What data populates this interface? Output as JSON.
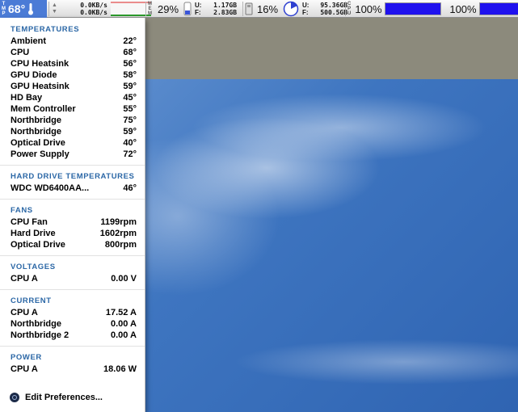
{
  "menubar": {
    "temp": {
      "label_letters": [
        "T",
        "M",
        "P"
      ],
      "value": "68°"
    },
    "network": {
      "up": "0.0KB/s",
      "down": "0.0KB/s"
    },
    "memory": {
      "label_letters": [
        "M",
        "E",
        "M"
      ],
      "percent": "29%",
      "used_label": "U:",
      "used": "1.17GB",
      "free_label": "F:",
      "free": "2.83GB"
    },
    "disk": {
      "percent": "16%",
      "used_label": "U:",
      "used": "95.36GB",
      "free_label": "F:",
      "free": "500.5GB"
    },
    "cpu": [
      {
        "percent": "100%",
        "level": 1.0
      },
      {
        "percent": "100%",
        "level": 1.0
      }
    ],
    "cpu_label_letters": [
      "C",
      "P",
      "U"
    ],
    "colors": {
      "temp_bg": "#4b7bd6",
      "cpu_bar": "#1f11ee",
      "section_heading": "#2b67a6"
    }
  },
  "menu": {
    "temperatures": {
      "heading": "TEMPERATURES",
      "rows": [
        {
          "name": "Ambient",
          "value": "22°"
        },
        {
          "name": "CPU",
          "value": "68°"
        },
        {
          "name": "CPU Heatsink",
          "value": "56°"
        },
        {
          "name": "GPU Diode",
          "value": "58°"
        },
        {
          "name": "GPU Heatsink",
          "value": "59°"
        },
        {
          "name": "HD Bay",
          "value": "45°"
        },
        {
          "name": "Mem Controller",
          "value": "55°"
        },
        {
          "name": "Northbridge",
          "value": "75°"
        },
        {
          "name": "Northbridge",
          "value": "59°"
        },
        {
          "name": "Optical Drive",
          "value": "40°"
        },
        {
          "name": "Power Supply",
          "value": "72°"
        }
      ]
    },
    "hd_temperatures": {
      "heading": "HARD DRIVE TEMPERATURES",
      "rows": [
        {
          "name": "WDC WD6400AA...",
          "value": "46°"
        }
      ]
    },
    "fans": {
      "heading": "FANS",
      "rows": [
        {
          "name": "CPU Fan",
          "value": "1199rpm"
        },
        {
          "name": "Hard Drive",
          "value": "1602rpm"
        },
        {
          "name": "Optical Drive",
          "value": "800rpm"
        }
      ]
    },
    "voltages": {
      "heading": "VOLTAGES",
      "rows": [
        {
          "name": "CPU A",
          "value": "0.00 V"
        }
      ]
    },
    "current": {
      "heading": "CURRENT",
      "rows": [
        {
          "name": "CPU A",
          "value": "17.52 A"
        },
        {
          "name": "Northbridge",
          "value": "0.00 A"
        },
        {
          "name": "Northbridge 2",
          "value": "0.00 A"
        }
      ]
    },
    "power": {
      "heading": "POWER",
      "rows": [
        {
          "name": "CPU A",
          "value": "18.06 W"
        }
      ]
    },
    "edit_preferences": "Edit Preferences..."
  }
}
